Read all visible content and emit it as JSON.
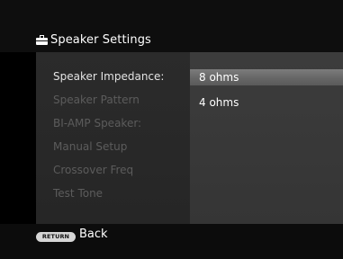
{
  "header": {
    "title": "Speaker Settings",
    "icon": "toolbox-icon"
  },
  "menu": {
    "items": [
      {
        "label": "Speaker Impedance:",
        "state": "active"
      },
      {
        "label": "Speaker Pattern",
        "state": "disabled"
      },
      {
        "label": "BI-AMP Speaker:",
        "state": "disabled"
      },
      {
        "label": "Manual Setup",
        "state": "disabled"
      },
      {
        "label": "Crossover Freq",
        "state": "disabled"
      },
      {
        "label": "Test Tone",
        "state": "disabled"
      }
    ]
  },
  "options": {
    "items": [
      {
        "label": "8 ohms",
        "selected": true
      },
      {
        "label": "4 ohms",
        "selected": false
      }
    ]
  },
  "footer": {
    "return_badge": "RETURN",
    "back_label": "Back"
  },
  "colors": {
    "background": "#000000",
    "left_panel": "#2a2a2a",
    "right_panel": "#3a3a3a",
    "selected_option": "#707070",
    "active_text": "#e3e3e3",
    "disabled_text": "#5c5c5c"
  }
}
